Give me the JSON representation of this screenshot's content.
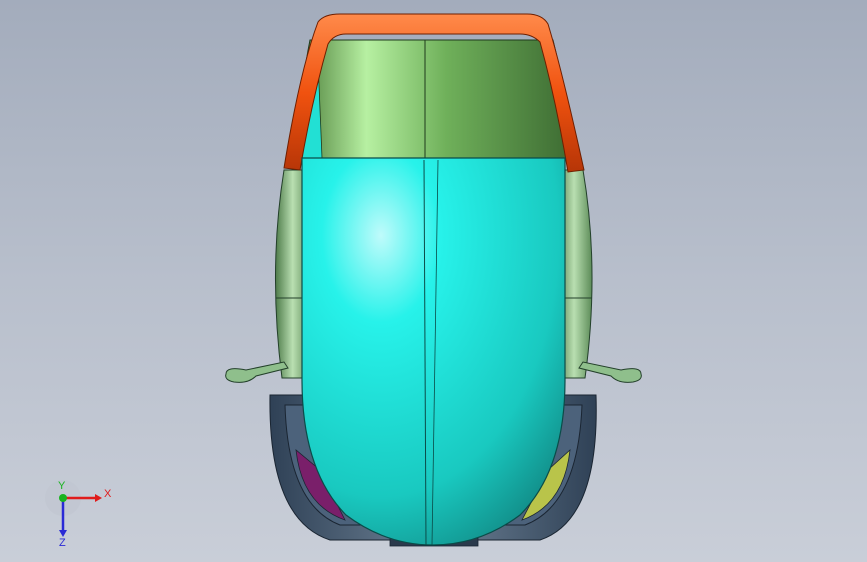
{
  "viewport": {
    "background_top": "#a3acbc",
    "background_bottom": "#c9ced8"
  },
  "model": {
    "colors": {
      "roof_bar": "#f0520f",
      "upper_canopy": "#7fbf6a",
      "body_shell": "#1fe3da",
      "side_panels": "#8fbf8c",
      "wheel": "#3b4f67",
      "accent_purple": "#7a1f6a",
      "accent_yellow": "#b9c44a"
    }
  },
  "triad": {
    "x_label": "X",
    "y_label": "Y",
    "z_label": "Z",
    "x_color": "#e01b1b",
    "y_color": "#19b31f",
    "z_color": "#2a2ad6"
  }
}
